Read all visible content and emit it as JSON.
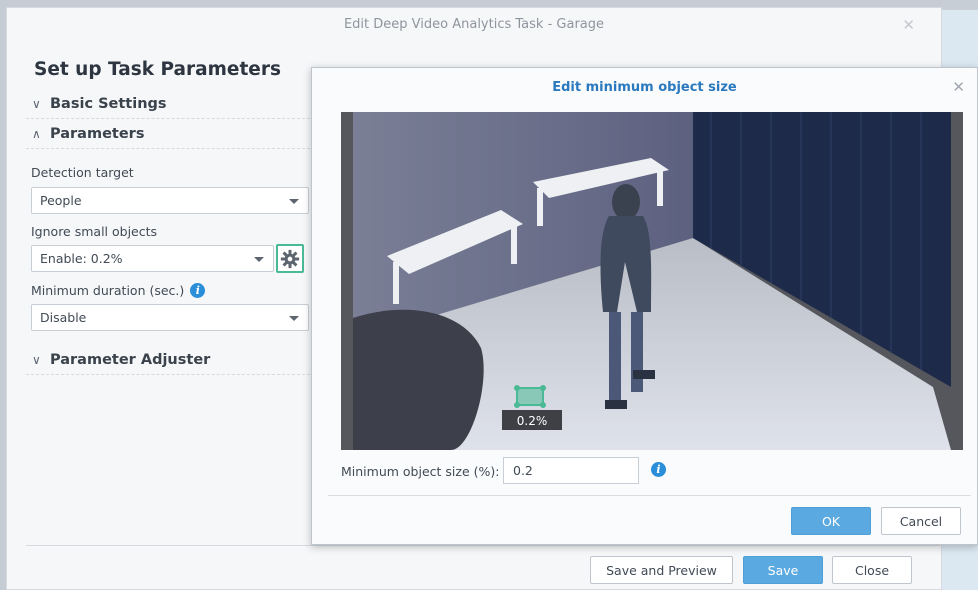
{
  "main_window": {
    "title": "Edit Deep Video Analytics Task - Garage",
    "close_glyph": "✕",
    "heading": "Set up Task Parameters",
    "sections": {
      "basic": {
        "label": "Basic Settings",
        "chev": "∨"
      },
      "parameters": {
        "label": "Parameters",
        "chev": "∧"
      },
      "adjuster": {
        "label": "Parameter Adjuster",
        "chev": "∨"
      }
    },
    "fields": {
      "detection_target": {
        "label": "Detection target",
        "value": "People"
      },
      "ignore_small": {
        "label": "Ignore small objects",
        "value": "Enable: 0.2%"
      },
      "min_duration": {
        "label": "Minimum duration (sec.)",
        "value": "Disable"
      }
    },
    "info_glyph": "i",
    "buttons": {
      "save_preview": "Save and Preview",
      "save": "Save",
      "close": "Close"
    }
  },
  "modal": {
    "title": "Edit minimum object size",
    "close_glyph": "✕",
    "overlay_label": "0.2%",
    "size_label": "Minimum object size (%):",
    "size_value": "0.2",
    "info_glyph": "i",
    "buttons": {
      "ok": "OK",
      "cancel": "Cancel"
    }
  },
  "colors": {
    "accent_blue": "#2a79be",
    "primary_button": "#5aa9e0",
    "box_green": "#4ab995",
    "info_blue": "#2a8fd8"
  }
}
